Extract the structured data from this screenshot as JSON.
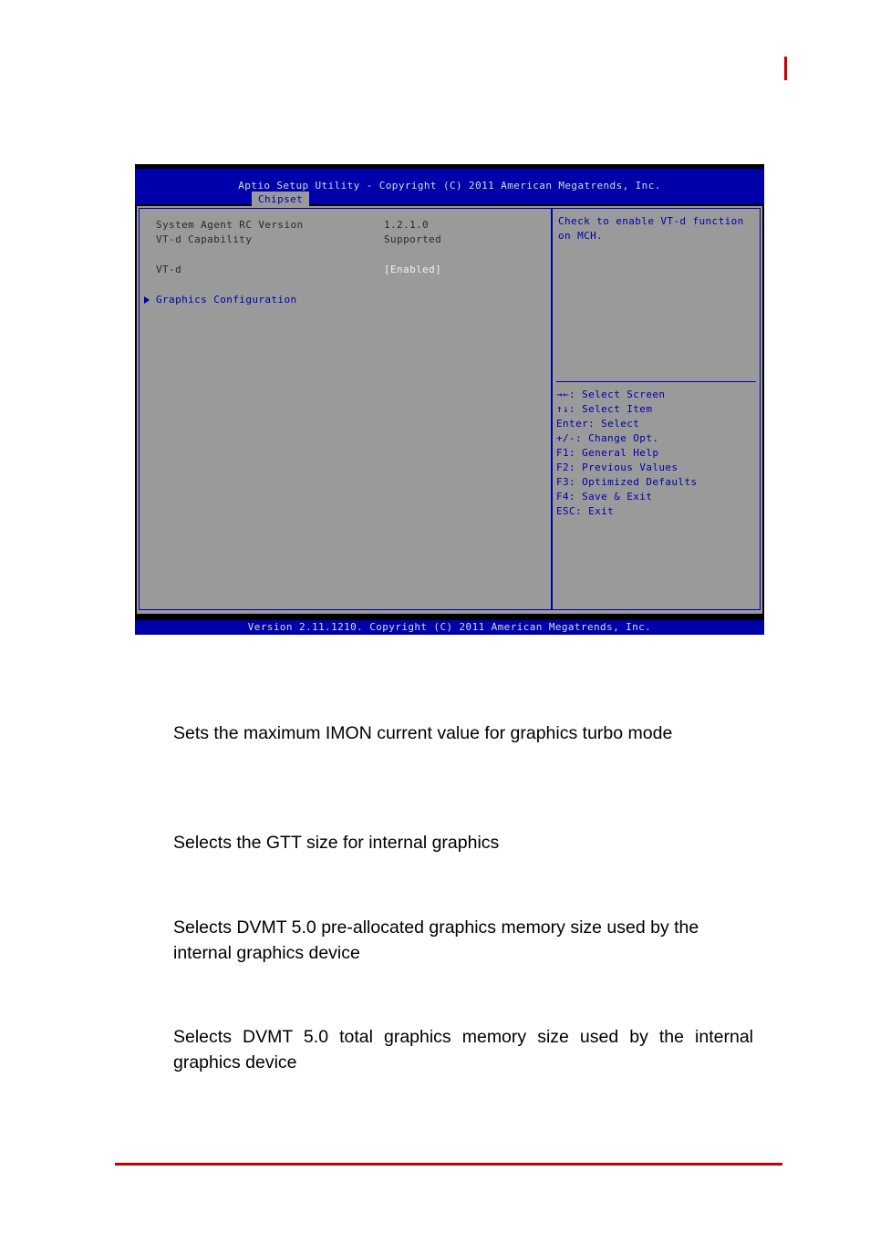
{
  "bios": {
    "title": "Aptio Setup Utility - Copyright (C) 2011 American Megatrends, Inc.",
    "tab": "Chipset",
    "settings": [
      {
        "label": "System Agent RC Version",
        "value": "1.2.1.0",
        "editable": false
      },
      {
        "label": "VT-d Capability",
        "value": "Supported",
        "editable": false
      },
      {
        "label": "VT-d",
        "value": "[Enabled]",
        "editable": true
      }
    ],
    "submenu": {
      "label": "Graphics Configuration",
      "arrow_icon": "triangle-right-icon"
    },
    "help": {
      "text": "Check to enable VT-d function\non MCH."
    },
    "legend": [
      "→←: Select Screen",
      "↑↓: Select Item",
      "Enter: Select",
      "+/-: Change Opt.",
      "F1: General Help",
      "F2: Previous Values",
      "F3: Optimized Defaults",
      "F4: Save & Exit",
      "ESC: Exit"
    ],
    "footer": "Version 2.11.1210. Copyright (C) 2011 American Megatrends, Inc.",
    "colors": {
      "chrome_blue": "#0000AA",
      "panel_gray": "#9A9A9A",
      "text_light": "#D8D8D8",
      "text_dark": "#2A2A2A"
    }
  },
  "document": {
    "paragraphs": [
      "Sets the maximum IMON current value for graphics turbo mode",
      "Selects the GTT size for internal graphics",
      "Selects DVMT 5.0 pre-allocated graphics memory size used by the internal graphics device",
      "Selects DVMT 5.0 total graphics memory size used by the internal graphics device"
    ],
    "accent_color": "#C00000"
  }
}
